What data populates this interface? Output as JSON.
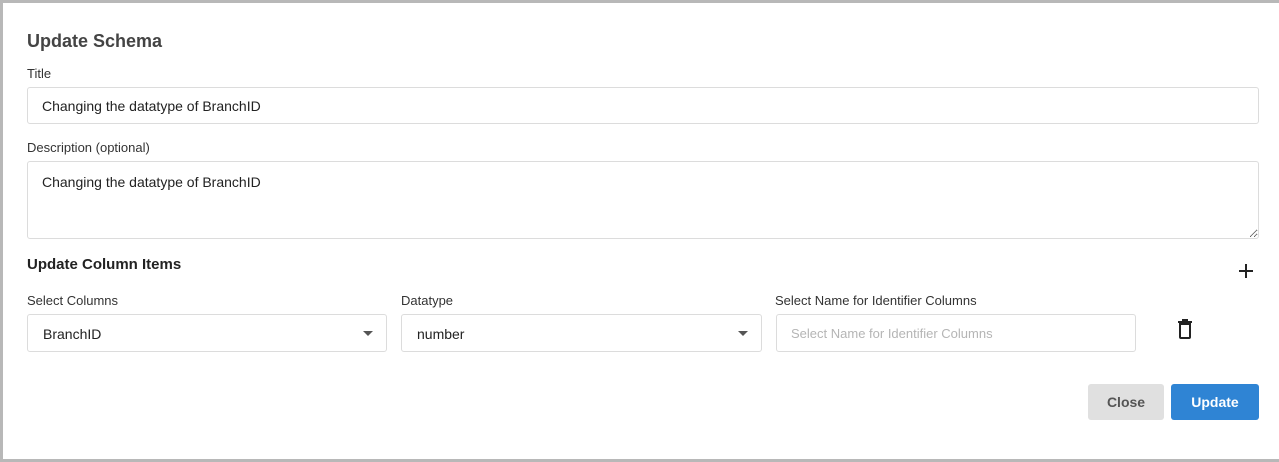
{
  "dialog": {
    "title": "Update Schema",
    "title_label": "Title",
    "title_value": "Changing the datatype of BranchID",
    "description_label": "Description (optional)",
    "description_value": "Changing the datatype of BranchID",
    "section_title": "Update Column Items",
    "columns": {
      "select_columns_label": "Select Columns",
      "select_columns_value": "BranchID",
      "datatype_label": "Datatype",
      "datatype_value": "number",
      "identifier_label": "Select Name for Identifier Columns",
      "identifier_placeholder": "Select Name for Identifier Columns"
    },
    "icons": {
      "add": "plus-icon",
      "delete": "trash-icon"
    },
    "buttons": {
      "close": "Close",
      "update": "Update"
    },
    "colors": {
      "primary": "#2f84d4",
      "secondary": "#e0e0e0"
    }
  }
}
